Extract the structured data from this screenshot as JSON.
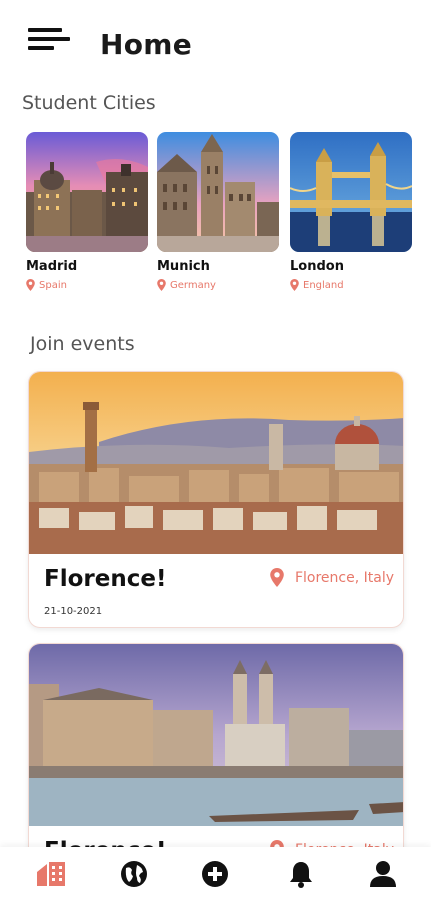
{
  "header": {
    "title": "Home"
  },
  "sections": {
    "cities_title": "Student Cities",
    "events_title": "Join events"
  },
  "cities": [
    {
      "name": "Madrid",
      "country": "Spain"
    },
    {
      "name": "Munich",
      "country": "Germany"
    },
    {
      "name": "London",
      "country": "England"
    }
  ],
  "events": [
    {
      "title": "Florence!",
      "location": "Florence, Italy",
      "date": "21-10-2021"
    },
    {
      "title": "Florence!",
      "location": "Florence, Italy",
      "date": ""
    }
  ],
  "nav": {
    "items": [
      {
        "icon": "home-icon",
        "active": true
      },
      {
        "icon": "globe-icon",
        "active": false
      },
      {
        "icon": "add-circle-icon",
        "active": false
      },
      {
        "icon": "bell-icon",
        "active": false
      },
      {
        "icon": "profile-icon",
        "active": false
      }
    ]
  },
  "colors": {
    "accent": "#e7786a",
    "text": "#111111",
    "muted": "#555555"
  }
}
